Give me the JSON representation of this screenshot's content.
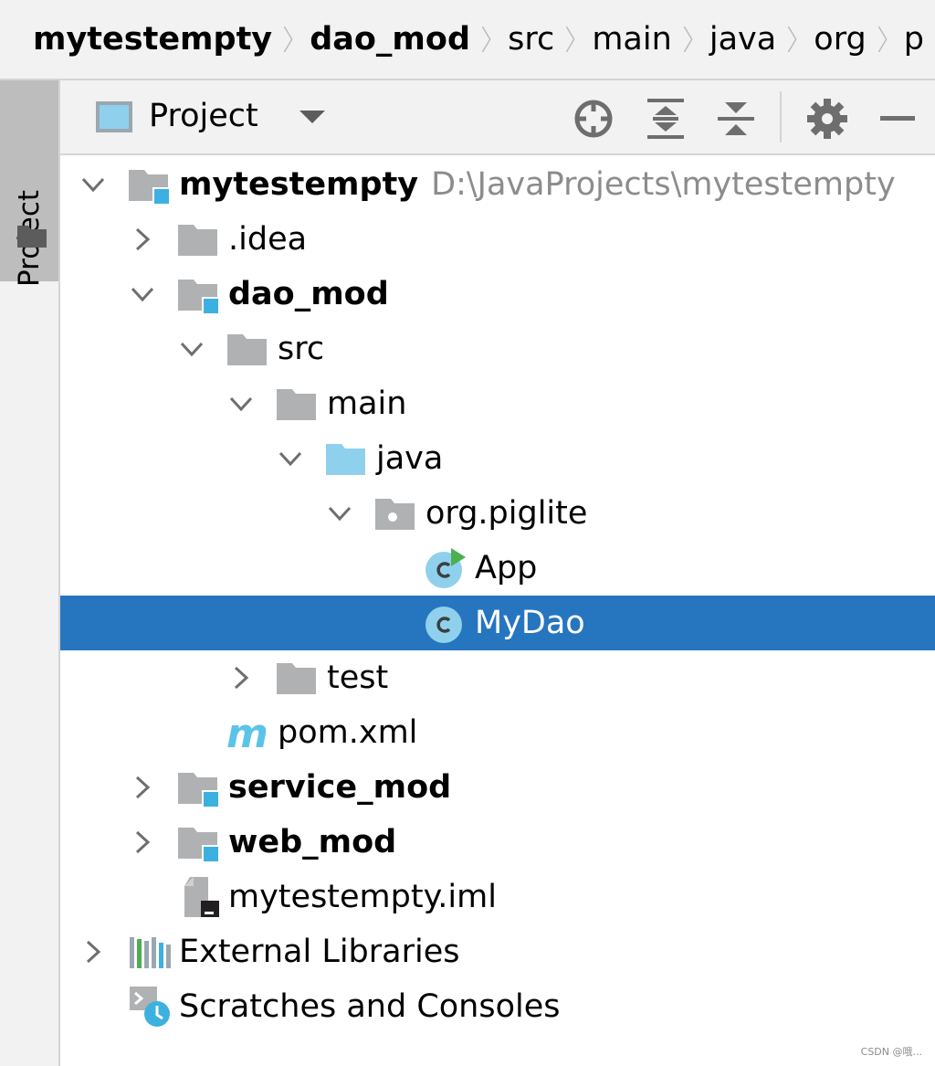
{
  "breadcrumb": [
    {
      "label": "mytestempty",
      "bold": true
    },
    {
      "label": "dao_mod",
      "bold": true
    },
    {
      "label": "src",
      "bold": false
    },
    {
      "label": "main",
      "bold": false
    },
    {
      "label": "java",
      "bold": false
    },
    {
      "label": "org",
      "bold": false
    },
    {
      "label": "p",
      "bold": false
    }
  ],
  "stripe": {
    "tab_label": "Project"
  },
  "header": {
    "title": "Project",
    "tools": [
      "locate-icon",
      "expand-all-icon",
      "collapse-all-icon",
      "gear-icon",
      "minimize-icon"
    ]
  },
  "tree": {
    "root_label": "mytestempty",
    "root_path": "D:\\JavaProjects\\mytestempty",
    "idea": ".idea",
    "dao_mod": "dao_mod",
    "src": "src",
    "main": "main",
    "java": "java",
    "package": "org.piglite",
    "app": "App",
    "mydao": "MyDao",
    "test": "test",
    "pom": "pom.xml",
    "service_mod": "service_mod",
    "web_mod": "web_mod",
    "iml": "mytestempty.iml",
    "external_libraries": "External Libraries",
    "scratches": "Scratches and Consoles",
    "selected": "MyDao"
  },
  "colors": {
    "selection": "#2675bf",
    "module_badge": "#3cb0e0",
    "folder_gray": "#afb1b3",
    "source_folder": "#8fd1ec",
    "run_green": "#4caf50"
  },
  "watermark": "CSDN @哦..."
}
